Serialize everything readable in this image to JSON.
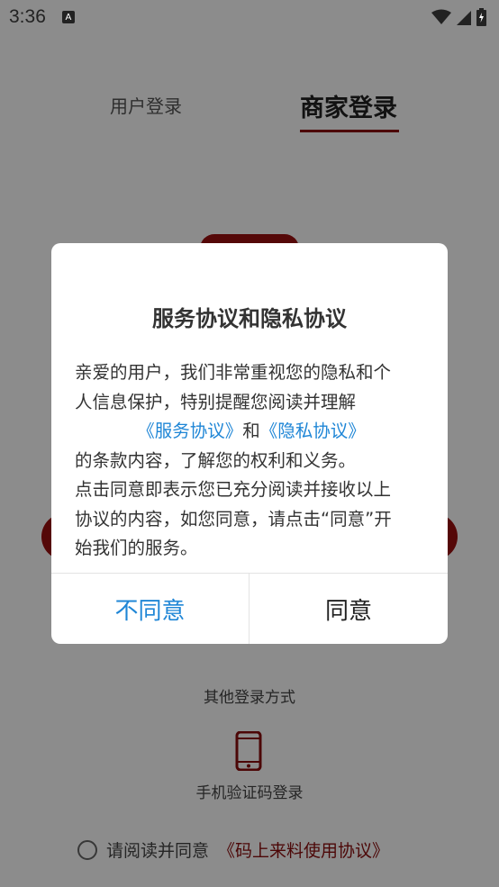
{
  "status_bar": {
    "time": "3:36",
    "notification_icon": "A",
    "icons": [
      "wifi-icon",
      "signal-icon",
      "battery-icon"
    ]
  },
  "tabs": {
    "user_login": "用户登录",
    "merchant_login": "商家登录"
  },
  "other_login": {
    "title": "其他登录方式",
    "phone_login": "手机验证码登录"
  },
  "agreement_row": {
    "prefix": "请阅读并同意",
    "link": "《码上来料使用协议》"
  },
  "dialog": {
    "title": "服务协议和隐私协议",
    "line1": "亲爱的用户，我们非常重视您的隐私和个",
    "line2": "人信息保护，特别提醒您阅读并理解",
    "service_link": "《服务协议》",
    "and": "和",
    "privacy_link": "《隐私协议》",
    "line4": "的条款内容，了解您的权利和义务。",
    "line5": "点击同意即表示您已充分阅读并接收以上",
    "line6": "协议的内容，如您同意，请点击“同意”开",
    "line7": "始我们的服务。",
    "disagree": "不同意",
    "agree": "同意"
  },
  "colors": {
    "brand_red": "#8b0d0d",
    "link_blue": "#1f86d6",
    "overlay": "rgba(0,0,0,0.45)"
  }
}
